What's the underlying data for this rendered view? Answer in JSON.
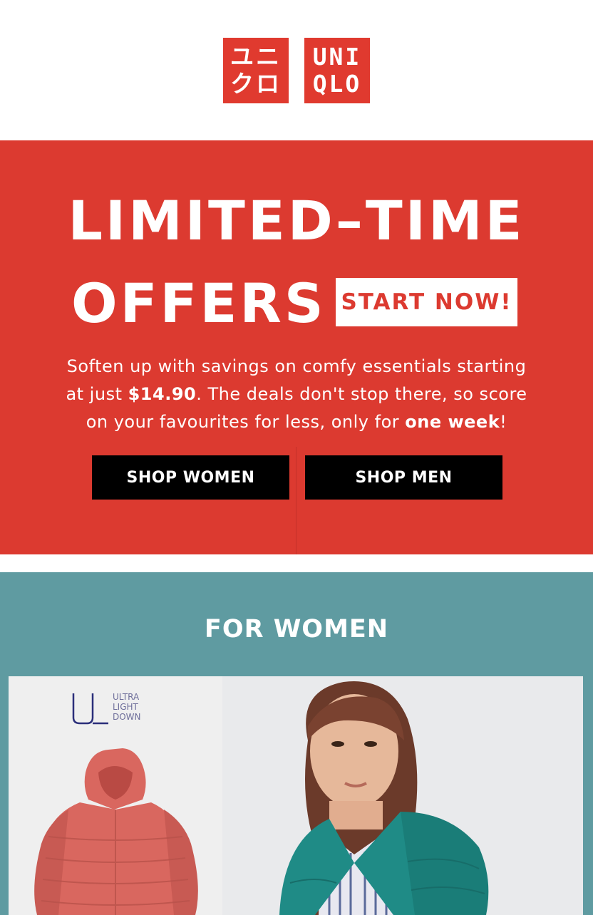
{
  "brand": {
    "logo_left_top": "ユニ",
    "logo_left_bottom": "クロ",
    "logo_right_top": "UNI",
    "logo_right_bottom": "QLO"
  },
  "hero": {
    "title_line1": "LIMITED–TIME",
    "title_line2": "OFFERS",
    "cta_start": "START NOW!",
    "copy_part1": "Soften up with savings on comfy essentials starting at just ",
    "copy_price": "$14.90",
    "copy_part2": ". The deals don't stop there, so score on your favourites for less, only for ",
    "copy_emph": "one week",
    "copy_end": "!",
    "btn_women": "SHOP WOMEN",
    "btn_men": "SHOP MEN"
  },
  "women_section": {
    "title": "FOR WOMEN",
    "uld_line1": "ULTRA",
    "uld_line2": "LIGHT",
    "uld_line3": "DOWN"
  },
  "colors": {
    "brand_red": "#dc3a30",
    "teal": "#5f9ba1",
    "button_black": "#000000",
    "jacket_coral": "#d9675f",
    "jacket_teal": "#1f8b86"
  }
}
